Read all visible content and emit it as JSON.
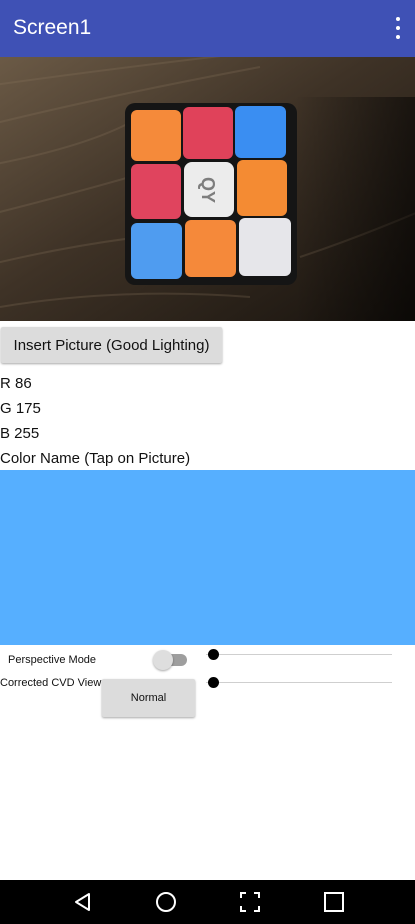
{
  "app_bar": {
    "title": "Screen1",
    "menu_icon": "more-vert-icon",
    "color": "#3f51b5"
  },
  "photo": {
    "subject": "rubiks-cube-photo",
    "logo_text": "QY"
  },
  "insert_button": {
    "label": "Insert Picture (Good Lighting)"
  },
  "color_info": {
    "r": "R 86",
    "g": "G 175",
    "b": "B 255",
    "name_hint": "Color Name (Tap on Picture)",
    "swatch_color": "#56afff"
  },
  "controls": {
    "perspective_label": "Perspective Mode",
    "perspective_on": false,
    "cvd_label": "Corrected CVD View",
    "cvd_button_label": "Normal",
    "slider_1_value": 0,
    "slider_2_value": 0
  },
  "nav_bar": {
    "back_icon": "back-triangle-icon",
    "home_icon": "home-circle-icon",
    "screenshot_icon": "screenshot-frame-icon",
    "recents_icon": "recents-square-icon"
  }
}
